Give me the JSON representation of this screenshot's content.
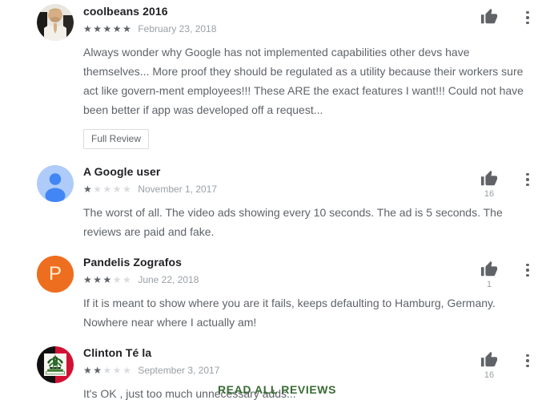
{
  "panel": {
    "read_all_label": "READ ALL REVIEWS",
    "accent_color": "#3a6b35",
    "star_on_color": "#5f6368",
    "star_off_color": "#dadce0",
    "text_color": "#5f6368",
    "author_color": "#202124"
  },
  "icons": {
    "thumb_up": "thumb-up-icon",
    "overflow": "overflow-menu-icon",
    "star_filled": "★",
    "star_empty": "★"
  },
  "reviews": [
    {
      "author": "coolbeans 2016",
      "rating": 5,
      "date": "February 23, 2018",
      "text": "Always wonder why Google has not implemented capabilities other devs have themselves... More proof they should be regulated as a utility because their workers sure act like govern-ment employees!!! These ARE the exact features I want!!! Could not have been better if app was developed off a request...",
      "thumb_count": "",
      "full_review_label": "Full Review",
      "avatar": {
        "type": "photo",
        "alt": "coolbeans 2016 profile photo"
      }
    },
    {
      "author": "A Google user",
      "rating": 1,
      "date": "November 1, 2017",
      "text": "The worst of all. The video ads showing every 10 seconds. The ad is 5 seconds. The reviews are paid and fake.",
      "thumb_count": "16",
      "full_review_label": "",
      "avatar": {
        "type": "default-user",
        "bg": "#aecbfa",
        "fg": "#4285f4"
      }
    },
    {
      "author": "Pandelis Zografos",
      "rating": 3,
      "date": "June 22, 2018",
      "text": "If it is meant to show where you are it fails, keeps defaulting to Hamburg, Germany. Nowhere near where I actually am!",
      "thumb_count": "1",
      "full_review_label": "",
      "avatar": {
        "type": "initial",
        "letter": "P",
        "bg": "#ee6e1f",
        "fg": "#fdf0d5"
      }
    },
    {
      "author": "Clinton Té la",
      "rating": 2,
      "date": "September 3, 2017",
      "text": "It's OK , just too much unnecessary adds...",
      "thumb_count": "16",
      "full_review_label": "",
      "avatar": {
        "type": "flag-haiti",
        "alt": "Haiti flag profile photo"
      }
    }
  ]
}
